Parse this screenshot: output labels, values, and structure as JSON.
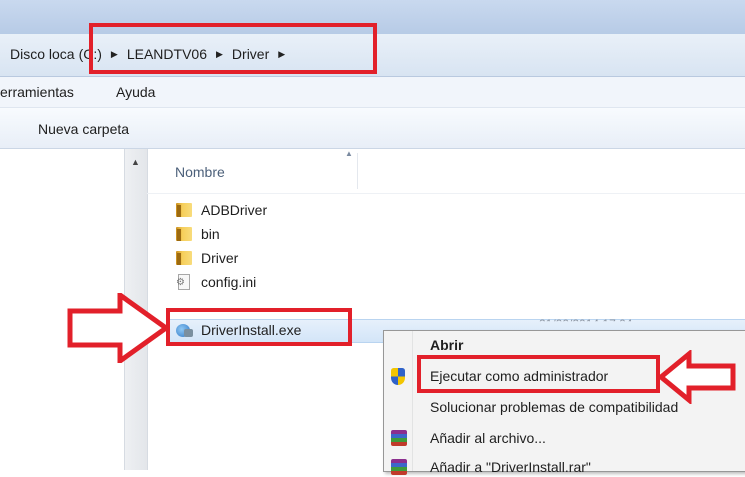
{
  "address_bar": {
    "segments": [
      "Disco loca",
      "(C:)",
      "LEANDTV06",
      "Driver"
    ],
    "separator_glyph": "▶"
  },
  "menubar": {
    "items": [
      "erramientas",
      "Ayuda"
    ]
  },
  "toolbar": {
    "new_folder_label": "Nueva carpeta"
  },
  "file_list": {
    "column_name": "Nombre",
    "files": [
      {
        "name": "ADBDriver",
        "icon": "folder-icon"
      },
      {
        "name": "bin",
        "icon": "folder-icon"
      },
      {
        "name": "Driver",
        "icon": "folder-icon"
      },
      {
        "name": "config.ini",
        "icon": "ini-file-icon"
      },
      {
        "name": "DriverInstall.exe",
        "icon": "exe-file-icon",
        "selected": true
      }
    ],
    "selected_row_details": "21/00/2014 17:04"
  },
  "context_menu": {
    "items": [
      {
        "label": "Abrir",
        "bold": true
      },
      {
        "label": "Ejecutar como administrador",
        "icon": "uac-shield-icon"
      },
      {
        "label": "Solucionar problemas de compatibilidad"
      },
      {
        "label": "Añadir al archivo...",
        "icon": "winrar-icon"
      },
      {
        "label": "Añadir a \"DriverInstall.rar\"",
        "icon": "winrar-icon"
      }
    ]
  },
  "colors": {
    "highlight_red": "#e2202a",
    "selection_blue": "#d3e5f8",
    "folder_yellow": "#f6cf5b"
  }
}
